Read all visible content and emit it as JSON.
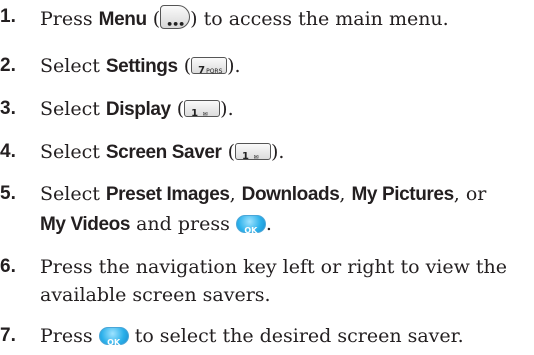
{
  "steps": [
    {
      "num": "1.",
      "pre": "Press ",
      "bold1": "Menu",
      "open": " (",
      "close": ") to access the main menu.",
      "key_icon": "menu-key-icon"
    },
    {
      "num": "2.",
      "pre": "Select ",
      "bold1": "Settings",
      "open": " (",
      "close": ").",
      "key_label": "7",
      "key_letters": "PQRS"
    },
    {
      "num": "3.",
      "pre": "Select ",
      "bold1": "Display",
      "open": " (",
      "close": ").",
      "key_label": "1",
      "key_symbol": "✉"
    },
    {
      "num": "4.",
      "pre": "Select ",
      "bold1": "Screen Saver",
      "open": " (",
      "close": ").",
      "key_label": "1",
      "key_symbol": "✉"
    },
    {
      "num": "5.",
      "pre": "Select ",
      "bold1": "Preset Images",
      "sep1": ", ",
      "bold2": "Downloads",
      "sep2": ", ",
      "bold3": "My Pictures",
      "tail": ", or",
      "line2_bold": "My Videos",
      "line2_text": " and press ",
      "line2_end": ".",
      "ok_label": "OK"
    },
    {
      "num": "6.",
      "text_line1": "Press the navigation key left or right to view the",
      "text_line2": "available screen savers."
    },
    {
      "num": "7.",
      "pre": "Press ",
      "post": " to select the desired screen saver.",
      "ok_label": "OK"
    }
  ]
}
